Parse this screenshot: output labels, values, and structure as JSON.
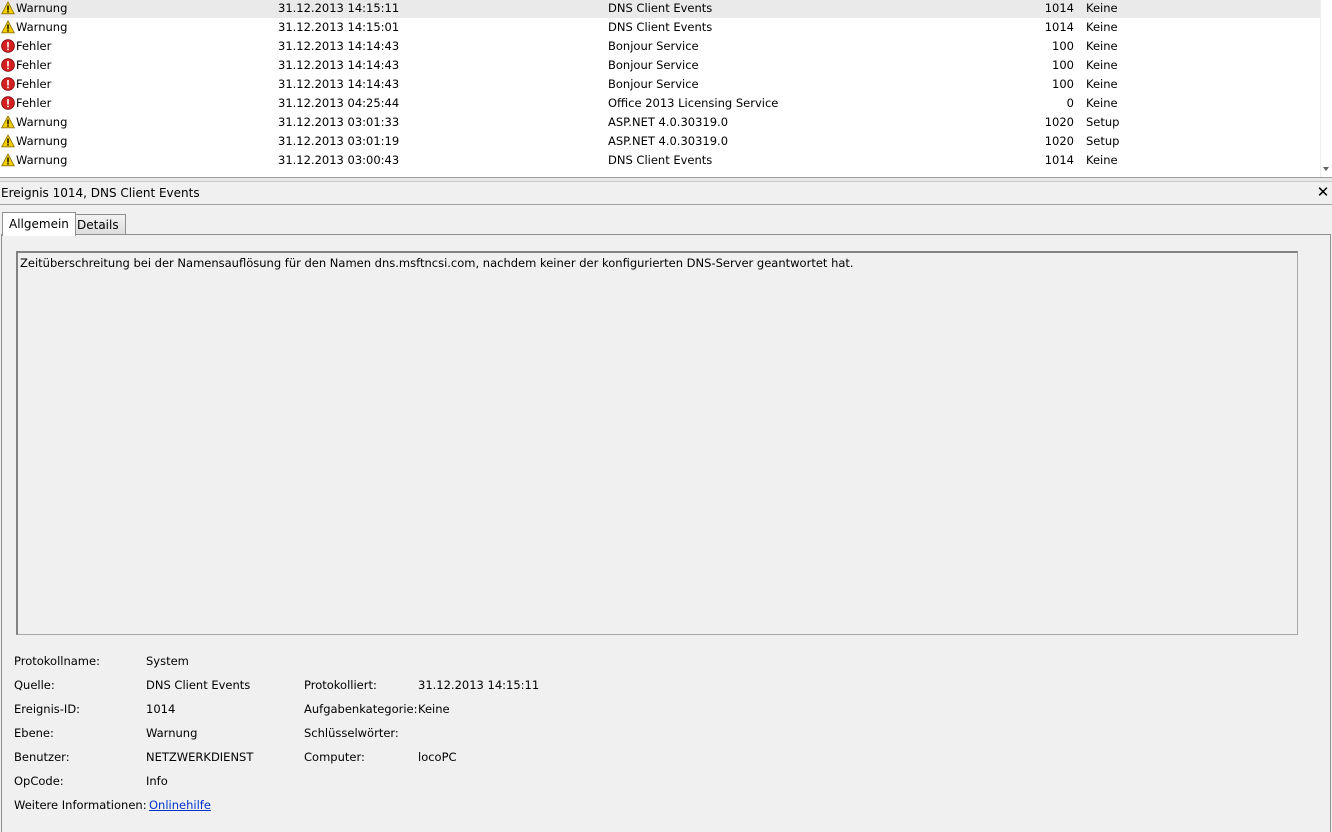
{
  "events": [
    {
      "level": "Warnung",
      "icon": "warning-icon",
      "date": "31.12.2013 14:15:11",
      "source": "DNS Client Events",
      "id": "1014",
      "task": "Keine",
      "selected": true
    },
    {
      "level": "Warnung",
      "icon": "warning-icon",
      "date": "31.12.2013 14:15:01",
      "source": "DNS Client Events",
      "id": "1014",
      "task": "Keine"
    },
    {
      "level": "Fehler",
      "icon": "error-icon",
      "date": "31.12.2013 14:14:43",
      "source": "Bonjour Service",
      "id": "100",
      "task": "Keine"
    },
    {
      "level": "Fehler",
      "icon": "error-icon",
      "date": "31.12.2013 14:14:43",
      "source": "Bonjour Service",
      "id": "100",
      "task": "Keine"
    },
    {
      "level": "Fehler",
      "icon": "error-icon",
      "date": "31.12.2013 14:14:43",
      "source": "Bonjour Service",
      "id": "100",
      "task": "Keine"
    },
    {
      "level": "Fehler",
      "icon": "error-icon",
      "date": "31.12.2013 04:25:44",
      "source": "Office 2013 Licensing Service",
      "id": "0",
      "task": "Keine"
    },
    {
      "level": "Warnung",
      "icon": "warning-icon",
      "date": "31.12.2013 03:01:33",
      "source": "ASP.NET 4.0.30319.0",
      "id": "1020",
      "task": "Setup"
    },
    {
      "level": "Warnung",
      "icon": "warning-icon",
      "date": "31.12.2013 03:01:19",
      "source": "ASP.NET 4.0.30319.0",
      "id": "1020",
      "task": "Setup"
    },
    {
      "level": "Warnung",
      "icon": "warning-icon",
      "date": "31.12.2013 03:00:43",
      "source": "DNS Client Events",
      "id": "1014",
      "task": "Keine"
    }
  ],
  "detail": {
    "title": "Ereignis 1014, DNS Client Events",
    "close_glyph": "✕",
    "tabs": {
      "general": "Allgemein",
      "details": "Details"
    },
    "message": "Zeitüberschreitung bei der Namensauflösung für den Namen dns.msftncsi.com, nachdem keiner der konfigurierten DNS-Server geantwortet hat.",
    "props": {
      "log_name_label": "Protokollname:",
      "log_name": "System",
      "source_label": "Quelle:",
      "source": "DNS Client Events",
      "logged_label": "Protokolliert:",
      "logged": "31.12.2013 14:15:11",
      "event_id_label": "Ereignis-ID:",
      "event_id": "1014",
      "task_category_label": "Aufgabenkategorie:",
      "task_category": "Keine",
      "level_label": "Ebene:",
      "level": "Warnung",
      "keywords_label": "Schlüsselwörter:",
      "keywords": "",
      "user_label": "Benutzer:",
      "user": "NETZWERKDIENST",
      "computer_label": "Computer:",
      "computer": "locoPC",
      "opcode_label": "OpCode:",
      "opcode": "Info",
      "more_info_label": "Weitere Informationen:",
      "more_info_link": "Onlinehilfe"
    }
  },
  "colors": {
    "warning": "#f5d000",
    "error": "#d42020",
    "link": "#0033cc"
  }
}
